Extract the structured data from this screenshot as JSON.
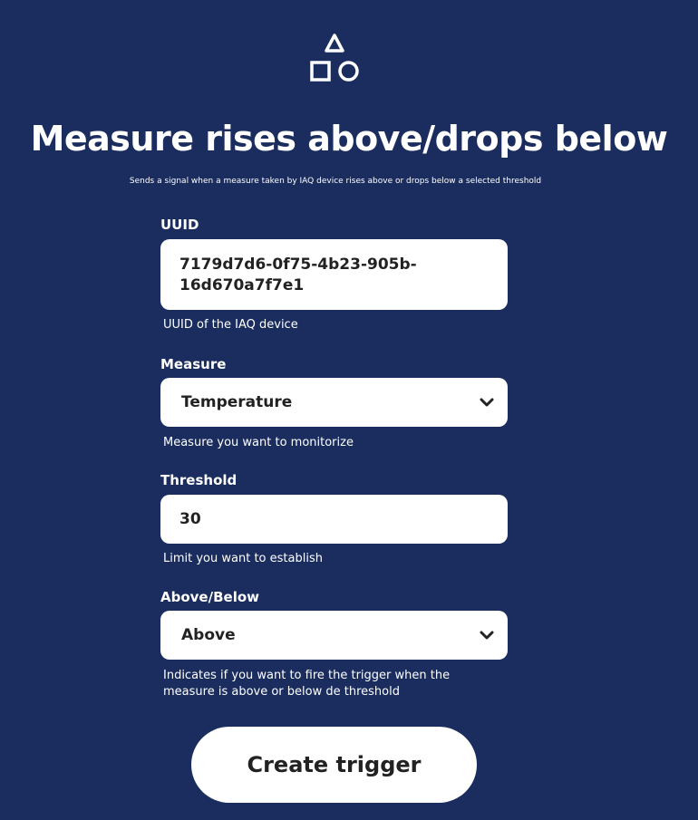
{
  "header": {
    "logo_icon": "shapes-icon",
    "title": "Measure rises above/drops below",
    "subtitle": "Sends a signal when a measure taken by IAQ device rises above or drops below a selected threshold"
  },
  "form": {
    "uuid": {
      "label": "UUID",
      "value_line1": "7179d7d6-0f75-4b23-905b-",
      "value_line2": "16d670a7f7e1",
      "help": "UUID of the IAQ device"
    },
    "measure": {
      "label": "Measure",
      "selected": "Temperature",
      "help": "Measure you want to monitorize",
      "icon": "chevron-down-icon"
    },
    "threshold": {
      "label": "Threshold",
      "value": "30",
      "help": "Limit you want to establish"
    },
    "above_below": {
      "label": "Above/Below",
      "selected": "Above",
      "help_line1": "Indicates if you want to fire the trigger when the",
      "help_line2": "measure is above or below de threshold",
      "icon": "chevron-down-icon"
    },
    "submit_label": "Create trigger"
  },
  "colors": {
    "background": "#1a2d5e",
    "surface": "#ffffff",
    "text_dark": "#222222"
  }
}
